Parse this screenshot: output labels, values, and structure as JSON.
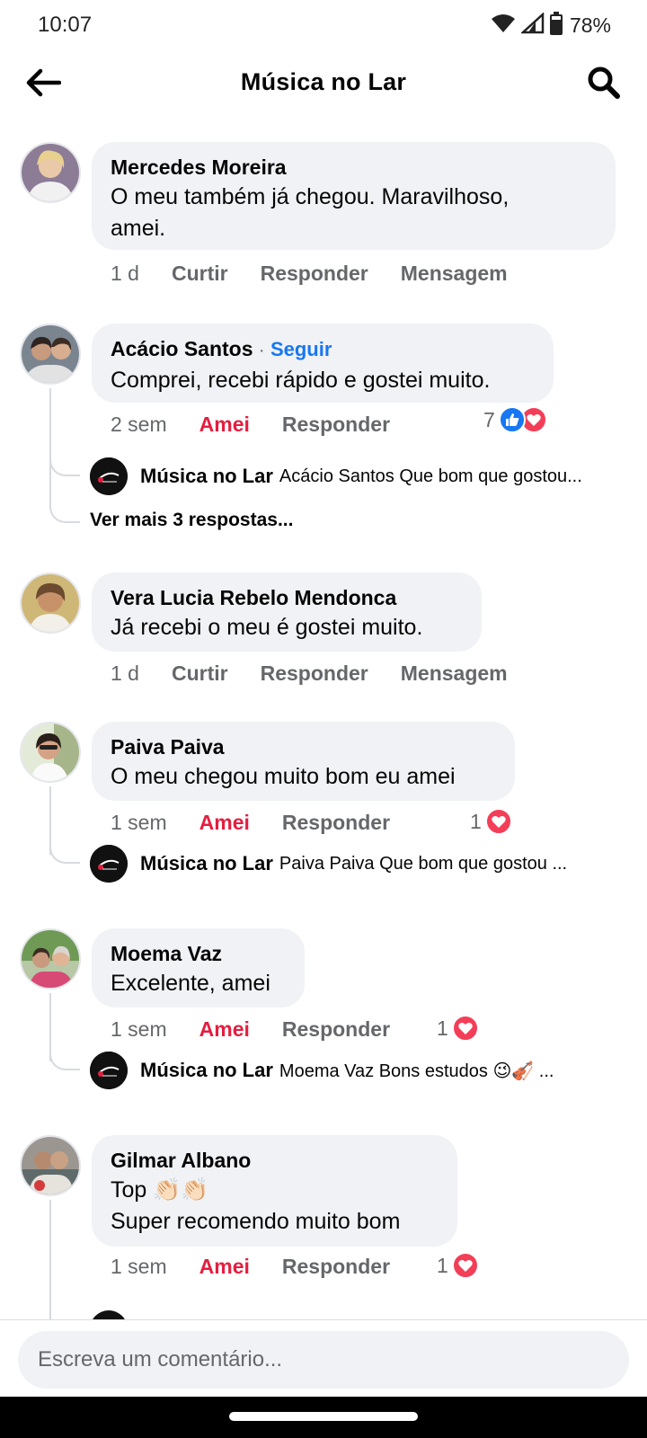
{
  "status_bar": {
    "time": "10:07",
    "battery": "78%"
  },
  "header": {
    "title": "Música no Lar"
  },
  "comments": [
    {
      "author": "Mercedes Moreira",
      "lines": [
        "O meu também já chegou. Maravilhoso,",
        "amei."
      ],
      "time": "1 d",
      "react_label": "Curtir",
      "reply_label": "Responder",
      "message_label": "Mensagem"
    },
    {
      "author": "Acácio Santos",
      "follow_sep": "·",
      "follow_label": "Seguir",
      "lines": [
        "Comprei, recebi rápido e gostei muito."
      ],
      "time": "2 sem",
      "react_label": "Amei",
      "reply_label": "Responder",
      "reaction_count": "7",
      "reply": {
        "name": "Música no Lar",
        "text": "Acácio Santos Que bom que gostou..."
      },
      "more_replies": "Ver mais 3 respostas..."
    },
    {
      "author": "Vera Lucia Rebelo Mendonca",
      "lines": [
        "Já recebi o meu é gostei muito."
      ],
      "time": "1 d",
      "react_label": "Curtir",
      "reply_label": "Responder",
      "message_label": "Mensagem"
    },
    {
      "author": "Paiva Paiva",
      "lines": [
        "O meu chegou muito bom eu amei"
      ],
      "time": "1 sem",
      "react_label": "Amei",
      "reply_label": "Responder",
      "reaction_count": "1",
      "reply": {
        "name": "Música no Lar",
        "text": "Paiva Paiva Que bom que gostou ..."
      }
    },
    {
      "author": "Moema Vaz",
      "lines": [
        "Excelente, amei"
      ],
      "time": "1 sem",
      "react_label": "Amei",
      "reply_label": "Responder",
      "reaction_count": "1",
      "reply": {
        "name": "Música no Lar",
        "text": "Moema Vaz Bons estudos 😉🎻 ..."
      }
    },
    {
      "author": "Gilmar Albano",
      "lines": [
        "Top 👏🏻👏🏻",
        "Super recomendo muito bom"
      ],
      "time": "1 sem",
      "react_label": "Amei",
      "reply_label": "Responder",
      "reaction_count": "1"
    }
  ],
  "composer": {
    "placeholder": "Escreva um comentário..."
  },
  "colors": {
    "accent_blue": "#1877f2",
    "love_red": "#e41e3f",
    "bubble_bg": "#f0f2f5",
    "muted_text": "#65676b"
  }
}
